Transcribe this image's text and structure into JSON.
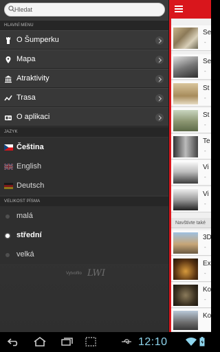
{
  "search": {
    "placeholder": "Hledat"
  },
  "sections": {
    "main_menu": "HLAVNÍ MENU",
    "language": "JAZYK",
    "font_size": "VELIKOST PÍSMA"
  },
  "menu": [
    {
      "label": "O Šumperku",
      "icon": "tower-icon"
    },
    {
      "label": "Mapa",
      "icon": "map-pin-icon"
    },
    {
      "label": "Atraktivity",
      "icon": "museum-icon"
    },
    {
      "label": "Trasa",
      "icon": "route-icon"
    },
    {
      "label": "O aplikaci",
      "icon": "info-icon"
    }
  ],
  "languages": [
    {
      "label": "Čeština",
      "selected": true,
      "icon": "czech-flag-icon"
    },
    {
      "label": "English",
      "selected": false,
      "icon": "uk-flag-icon"
    },
    {
      "label": "Deutsch",
      "selected": false,
      "icon": "german-flag-icon"
    }
  ],
  "font_sizes": [
    {
      "label": "malá",
      "selected": false
    },
    {
      "label": "střední",
      "selected": true
    },
    {
      "label": "velká",
      "selected": false
    }
  ],
  "credit": {
    "text": "Vytvořilo",
    "logo": "LWI"
  },
  "content": {
    "rows_top": [
      {
        "title": "Se",
        "sub": "-"
      },
      {
        "title": "Se",
        "sub": "-"
      },
      {
        "title": "St",
        "sub": "-"
      },
      {
        "title": "St",
        "sub": "-"
      },
      {
        "title": "Te",
        "sub": "-"
      },
      {
        "title": "Vi",
        "sub": "-"
      },
      {
        "title": "Vi",
        "sub": "-"
      }
    ],
    "subheader": "Navštivte také",
    "rows_bottom": [
      {
        "title": "3D",
        "sub": "-"
      },
      {
        "title": "Ex",
        "sub": "-"
      },
      {
        "title": "Ko",
        "sub": "-"
      },
      {
        "title": "Ko",
        "sub": "-"
      }
    ]
  },
  "status": {
    "time": "12:10"
  },
  "colors": {
    "accent": "#d9161c",
    "drawer": "#383838",
    "clock": "#8fd6ee"
  }
}
